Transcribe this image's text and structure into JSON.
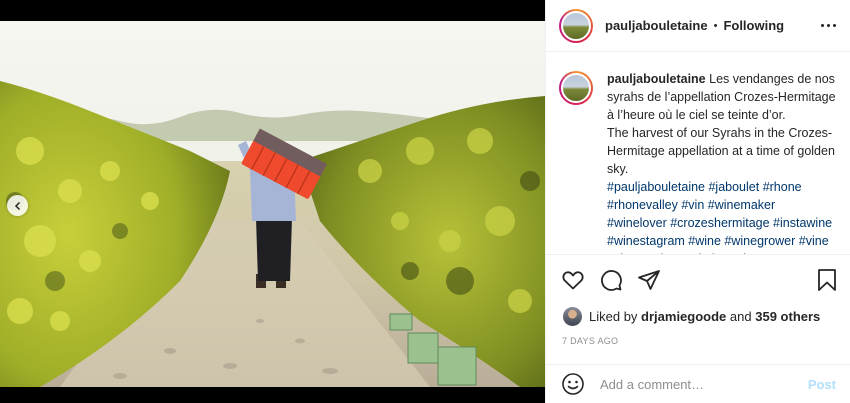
{
  "post": {
    "username": "pauljabouletaine",
    "follow_status": "Following",
    "dot": "•",
    "caption_lines": [
      "Les vendanges de nos syrahs de l’appellation Crozes-Hermitage à l’heure où le ciel se teinte d’or.",
      "The harvest of our Syrahs in the Crozes-Hermitage appellation at a time of golden sky."
    ],
    "hashtags": "#pauljabouletaine #jaboulet #rhone #rhonevalley #vin #winemaker #winelover #crozeshermitage #instawine #winestagram #wine #winegrower #vine #vigne #vineyard #igersdrome",
    "liked_by_prefix": "Liked by",
    "liked_by_user": "drjamiegoode",
    "liked_by_joiner": "and",
    "liked_by_others": "359 others",
    "date": "7 DAYS AGO"
  },
  "comment": {
    "placeholder": "Add a comment…",
    "post_label": "Post"
  },
  "icons": {
    "carousel_prev": "chevron-left-icon",
    "more": "more-options-icon",
    "like": "heart-icon",
    "comment": "comment-icon",
    "share": "share-icon",
    "save": "bookmark-icon",
    "emoji": "emoji-icon"
  },
  "colors": {
    "link_blue": "#00376b",
    "post_button_disabled": "#b2dffc",
    "muted_text": "#8e8e8e",
    "divider": "#efefef"
  }
}
